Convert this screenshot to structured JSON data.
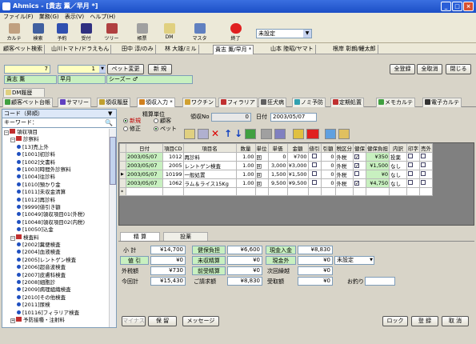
{
  "window": {
    "title": "Ahmics - [貴志 薫／早月 *]",
    "minimize": "_",
    "maximize": "□",
    "close": "×"
  },
  "menu": [
    "ファイル(F)",
    "業務(G)",
    "表示(V)",
    "ヘルプ(H)"
  ],
  "toolbar": [
    {
      "label": "カルテ",
      "icon": "skull-icon",
      "color": "#c0a080"
    },
    {
      "label": "検索",
      "icon": "binoculars-icon",
      "color": "#4060a0"
    },
    {
      "label": "予約",
      "icon": "calendar-icon",
      "color": "#3050b0"
    },
    {
      "label": "受付",
      "icon": "reception-icon",
      "color": "#303080"
    },
    {
      "label": "ツリー",
      "icon": "tree-icon",
      "color": "#b04040"
    },
    {
      "label": "帳票",
      "icon": "printer-icon",
      "color": "#a0a0a0"
    },
    {
      "label": "DM",
      "icon": "mail-icon",
      "color": "#e0d080"
    },
    {
      "label": "マスタ",
      "icon": "master-icon",
      "color": "#6080c0"
    },
    {
      "label": "終了",
      "icon": "exit-icon",
      "color": "#e02020"
    }
  ],
  "patient_select": {
    "value": "未設定"
  },
  "patient_tabs": [
    "顧客ペット検索",
    "山川トマト/ドラえもん",
    "田中 淳/のみ",
    "林 大雄/ミル",
    "貴志 薫/早月 *",
    "山本 陸昭/ヤマト",
    "根岸 彰朗/鯉太郎"
  ],
  "customer": {
    "number": "7",
    "pet_number": "1",
    "name": "貴志 薫",
    "pet_name": "早月",
    "breed": "シーズー ♂",
    "pet_change": "ペット変更",
    "new": "新 規"
  },
  "top_buttons": {
    "register_all": "全登録",
    "cancel_all": "全取消",
    "close": "閉じる"
  },
  "dm_history_tab": "DM履歴",
  "feature_tabs": [
    {
      "label": "顧客ペット台帳",
      "color": "#40a040"
    },
    {
      "label": "サマリー",
      "color": "#6040c0"
    },
    {
      "label": "領収履歴",
      "color": "#c0a030"
    },
    {
      "label": "領収入力 *",
      "color": "#d08020"
    },
    {
      "label": "ワクチン",
      "color": "#d0a030"
    },
    {
      "label": "フィラリア",
      "color": "#c03030"
    },
    {
      "label": "狂犬病",
      "color": "#606060"
    },
    {
      "label": "ノミ予防",
      "color": "#30a0b0"
    },
    {
      "label": "定期処置",
      "color": "#c03030"
    },
    {
      "label": "メモカルテ",
      "color": "#40a040"
    },
    {
      "label": "電子カルテ",
      "color": "#333333"
    }
  ],
  "code_panel": {
    "header": "コード（昇順）",
    "keyword": "キーワード："
  },
  "tree": [
    {
      "level": 0,
      "label": "領収項目",
      "kind": "folder",
      "expanded": true
    },
    {
      "level": 1,
      "label": "診察料",
      "kind": "folder",
      "expanded": true
    },
    {
      "level": 2,
      "label": "[13]売上外",
      "kind": "item"
    },
    {
      "level": 2,
      "label": "[1001]初診料",
      "kind": "item"
    },
    {
      "level": 2,
      "label": "[1002]文書料",
      "kind": "item"
    },
    {
      "level": 2,
      "label": "[1003]時間外診察料",
      "kind": "item"
    },
    {
      "level": 2,
      "label": "[1004]往診料",
      "kind": "item"
    },
    {
      "level": 2,
      "label": "[1010]預かり金",
      "kind": "item"
    },
    {
      "level": 2,
      "label": "[1011]未収金清算",
      "kind": "item"
    },
    {
      "level": 2,
      "label": "[1012]再診料",
      "kind": "item"
    },
    {
      "level": 2,
      "label": "[9999]値引き額",
      "kind": "item"
    },
    {
      "level": 2,
      "label": "[10049]領収項目01(外税)",
      "kind": "item"
    },
    {
      "level": 2,
      "label": "[10048]領収項目02(内税)",
      "kind": "item"
    },
    {
      "level": 2,
      "label": "[10050]込金",
      "kind": "item"
    },
    {
      "level": 1,
      "label": "検査料",
      "kind": "folder",
      "expanded": true
    },
    {
      "level": 2,
      "label": "[2002]糞便検査",
      "kind": "item"
    },
    {
      "level": 2,
      "label": "[2004]血液検査",
      "kind": "item"
    },
    {
      "level": 2,
      "label": "[2005]レントゲン検査",
      "kind": "item"
    },
    {
      "level": 2,
      "label": "[2006]超音波検査",
      "kind": "item"
    },
    {
      "level": 2,
      "label": "[2007]皮膚科検査",
      "kind": "item"
    },
    {
      "level": 2,
      "label": "[2008]細胞診",
      "kind": "item"
    },
    {
      "level": 2,
      "label": "[2009]病理組織検査",
      "kind": "item"
    },
    {
      "level": 2,
      "label": "[2010]その他検査",
      "kind": "item"
    },
    {
      "level": 2,
      "label": "[2011]尿検",
      "kind": "item"
    },
    {
      "level": 2,
      "label": "[10116]フィラリア検査",
      "kind": "item"
    },
    {
      "level": 1,
      "label": "予防接種・注射料",
      "kind": "folder",
      "expanded": false
    }
  ],
  "receipt": {
    "price_unit_label": "精算単位",
    "radio_new": "新規",
    "radio_edit": "修正",
    "radio_customer": "顧客",
    "radio_pet": "ペット",
    "receipt_no_label": "領収No",
    "receipt_no": "0",
    "date_label": "日付",
    "date": "2003/05/07"
  },
  "grid": {
    "headers": [
      "日付",
      "項目CD",
      "項目名",
      "数量",
      "単位",
      "単価",
      "金額",
      "値引",
      "引額",
      "税区分",
      "健保",
      "健保負担",
      "内訳",
      "印字",
      "売外"
    ],
    "rows": [
      {
        "date": "2003/05/07",
        "cd": "1012",
        "name": "再診料",
        "qty": "1.00",
        "unit": "回",
        "price": "0",
        "amount": "¥700",
        "disc": "",
        "discamt": "0",
        "tax": "外税",
        "ins": true,
        "insamt": "¥350",
        "detail": "投薬",
        "print": false,
        "exclude": false
      },
      {
        "date": "2003/05/07",
        "cd": "2005",
        "name": "レントゲン検査",
        "qty": "1.00",
        "unit": "回",
        "price": "3,000",
        "amount": "¥3,000",
        "disc": "",
        "discamt": "0",
        "tax": "外税",
        "ins": true,
        "insamt": "¥1,500",
        "detail": "なし",
        "print": false,
        "exclude": false
      },
      {
        "date": "2003/05/07",
        "cd": "10199",
        "name": "一般処置",
        "qty": "1.00",
        "unit": "回",
        "price": "1,500",
        "amount": "¥1,500",
        "disc": "",
        "discamt": "0",
        "tax": "外税",
        "ins": false,
        "insamt": "¥0",
        "detail": "なし",
        "print": false,
        "exclude": false
      },
      {
        "date": "2003/05/07",
        "cd": "1062",
        "name": "ラム＆ライス15Kg",
        "qty": "1.00",
        "unit": "回",
        "price": "9,500",
        "amount": "¥9,500",
        "disc": "",
        "discamt": "0",
        "tax": "外税",
        "ins": true,
        "insamt": "¥4,750",
        "detail": "なし",
        "print": false,
        "exclude": false
      }
    ]
  },
  "bottom_tabs": [
    "精 算",
    "投薬"
  ],
  "summary": {
    "subtotal_label": "小 計",
    "subtotal": "¥14,700",
    "discount_label": "値 引",
    "discount": "¥0",
    "tax_label": "外税額",
    "tax": "¥730",
    "total_label": "今回計",
    "total": "¥15,430",
    "ins_burden_label": "健保負担",
    "ins_burden": "¥6,600",
    "unpaid_label": "未収精算",
    "unpaid": "¥0",
    "advance_label": "前受精算",
    "advance": "¥0",
    "billed_label": "ご請求額",
    "billed": "¥8,830",
    "cash_in_label": "現金入金",
    "cash_in": "¥8,830",
    "cash_out_label": "現金外",
    "cash_out": "¥0",
    "cash_out_select": "未設定",
    "carry_label": "次回繰越",
    "carry": "¥0",
    "received_label": "受取額",
    "received": "¥0",
    "change_label": "お釣り",
    "change": ""
  },
  "footer": {
    "minus": "マイナス",
    "hold": "保 留",
    "message": "メッセージ",
    "lock": "ロック",
    "register": "登 録",
    "cancel": "取 消"
  }
}
